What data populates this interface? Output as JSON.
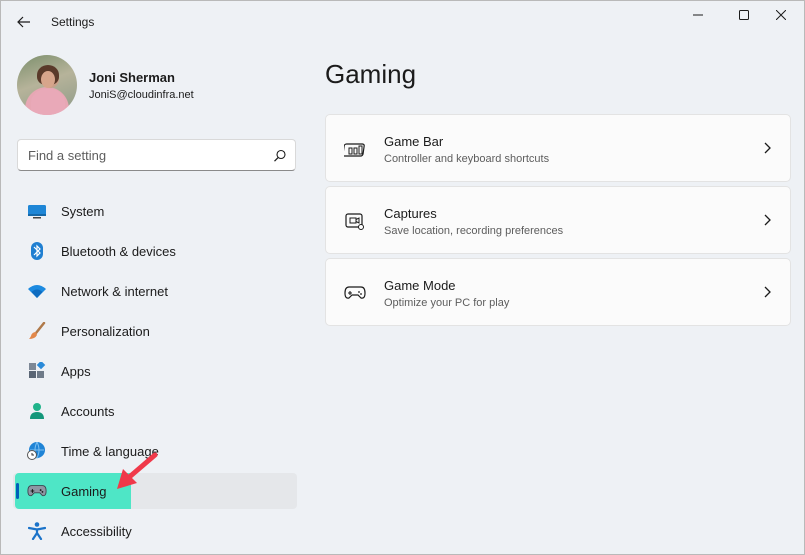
{
  "window": {
    "title": "Settings",
    "back_icon": "arrow-left-icon",
    "min_icon": "minimize-icon",
    "max_icon": "maximize-icon",
    "close_icon": "close-icon"
  },
  "profile": {
    "name": "Joni Sherman",
    "email": "JoniS@cloudinfra.net"
  },
  "search": {
    "placeholder": "Find a setting",
    "value": "",
    "icon": "search-icon"
  },
  "sidebar": {
    "items": [
      {
        "label": "System",
        "icon": "system-display-icon",
        "selected": false
      },
      {
        "label": "Bluetooth & devices",
        "icon": "bluetooth-icon",
        "selected": false
      },
      {
        "label": "Network & internet",
        "icon": "wifi-icon",
        "selected": false
      },
      {
        "label": "Personalization",
        "icon": "paintbrush-icon",
        "selected": false
      },
      {
        "label": "Apps",
        "icon": "apps-icon",
        "selected": false
      },
      {
        "label": "Accounts",
        "icon": "person-icon",
        "selected": false
      },
      {
        "label": "Time & language",
        "icon": "globe-clock-icon",
        "selected": false
      },
      {
        "label": "Gaming",
        "icon": "gamepad-icon",
        "selected": true
      },
      {
        "label": "Accessibility",
        "icon": "accessibility-icon",
        "selected": false
      }
    ]
  },
  "main": {
    "title": "Gaming",
    "cards": [
      {
        "title": "Game Bar",
        "subtitle": "Controller and keyboard shortcuts",
        "icon": "game-bar-icon"
      },
      {
        "title": "Captures",
        "subtitle": "Save location, recording preferences",
        "icon": "capture-icon"
      },
      {
        "title": "Game Mode",
        "subtitle": "Optimize your PC for play",
        "icon": "gamepad-icon"
      }
    ]
  },
  "colors": {
    "accent": "#005fb8",
    "highlight": "#4ee6c6",
    "annotation_arrow": "#f0394a"
  }
}
